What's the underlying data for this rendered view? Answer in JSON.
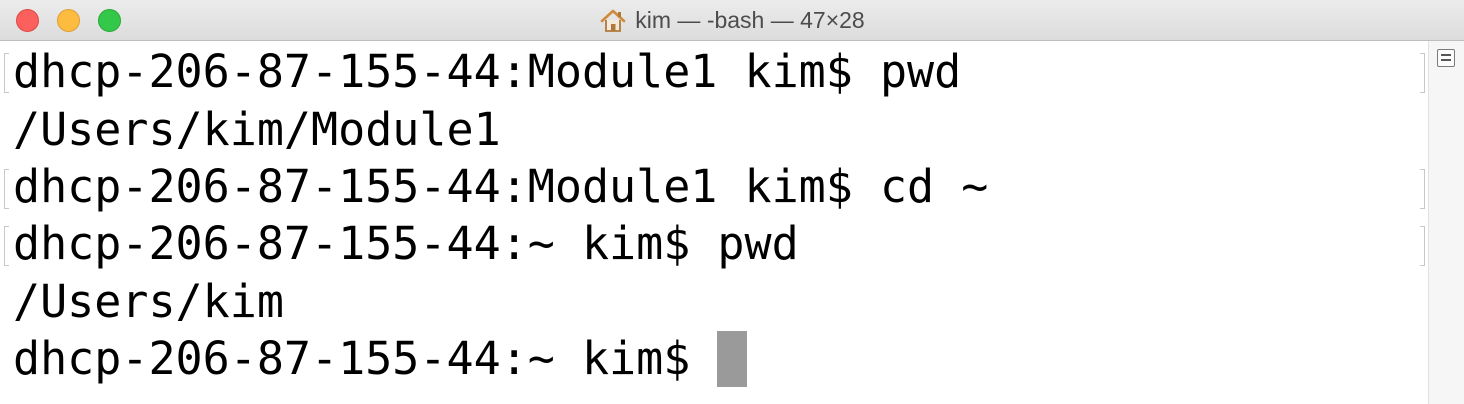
{
  "window": {
    "title": "kim — -bash — 47×28",
    "title_icon": "home-icon"
  },
  "terminal": {
    "lines": [
      {
        "type": "prompt",
        "text": "dhcp-206-87-155-44:Module1 kim$ pwd"
      },
      {
        "type": "output",
        "text": "/Users/kim/Module1"
      },
      {
        "type": "prompt",
        "text": "dhcp-206-87-155-44:Module1 kim$ cd ~"
      },
      {
        "type": "prompt",
        "text": "dhcp-206-87-155-44:~ kim$ pwd"
      },
      {
        "type": "output",
        "text": "/Users/kim"
      },
      {
        "type": "prompt",
        "text": "dhcp-206-87-155-44:~ kim$ "
      }
    ],
    "cursor_color": "#9a9a9a"
  },
  "scrollbar": {
    "icon": "split-pane-icon"
  },
  "colors": {
    "close": "#fc605c",
    "minimize": "#fdbc40",
    "maximize": "#34c84a",
    "text": "#000000",
    "background": "#ffffff"
  }
}
